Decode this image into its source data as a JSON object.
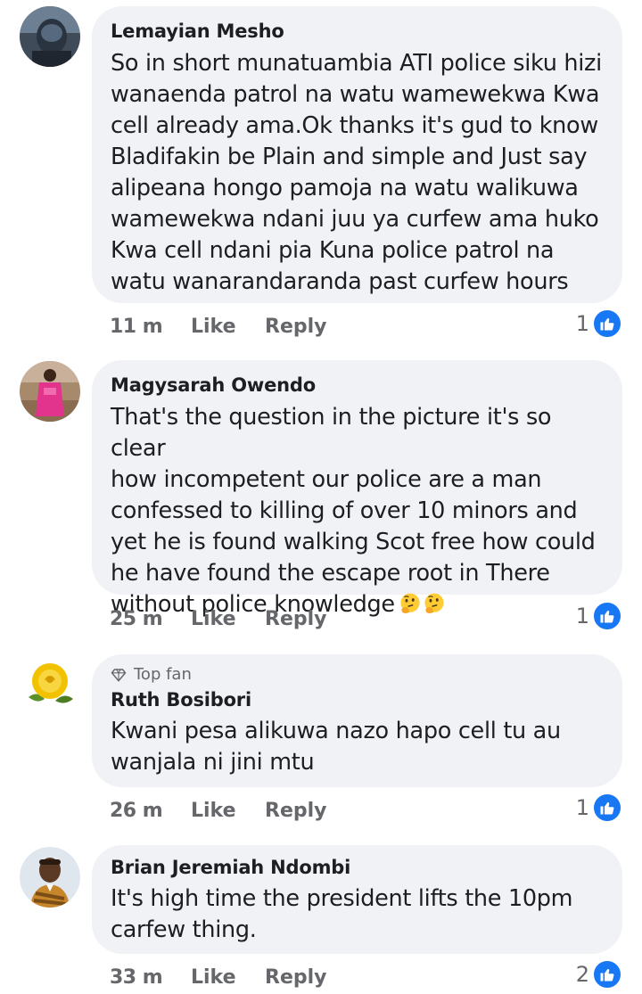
{
  "comments": [
    {
      "author": "Lemayian Mesho",
      "text": "So in short munatuambia ATI police siku hizi\nwanaenda patrol na watu wamewekwa Kwa\ncell already ama.Ok thanks it's gud to know\nBladifakin be Plain and simple and Just say\nalipeana hongo pamoja na watu walikuwa\nwamewekwa ndani juu ya curfew ama huko\nKwa cell ndani pia Kuna police patrol na\nwatu wanarandaranda past curfew hours",
      "time": "11 m",
      "like_label": "Like",
      "reply_label": "Reply",
      "reaction_count": "1",
      "avatar": "dark-portrait-avatar"
    },
    {
      "author": "Magysarah Owendo",
      "text": "That's the question in the picture  it's so clear\nhow incompetent our police are a man\nconfessed to killing of over 10 minors  and\nyet he is found walking Scot free how could\nhe have found the escape root in  There\nwithout police knowledge",
      "emojis": [
        "thinking-face-emoji",
        "thinking-face-emoji"
      ],
      "time": "25 m",
      "like_label": "Like",
      "reply_label": "Reply",
      "reaction_count": "1",
      "avatar": "pink-dress-avatar"
    },
    {
      "badge": "Top fan",
      "badge_icon": "diamond-icon",
      "author": "Ruth Bosibori",
      "text": "Kwani pesa alikuwa nazo hapo cell tu au\nwanjala ni jini mtu",
      "time": "26 m",
      "like_label": "Like",
      "reply_label": "Reply",
      "reaction_count": "1",
      "avatar": "yellow-rose-avatar"
    },
    {
      "author": "Brian Jeremiah Ndombi",
      "text": "It's high time the president lifts the 10pm\ncarfew thing.",
      "time": "33 m",
      "like_label": "Like",
      "reply_label": "Reply",
      "reaction_count": "2",
      "avatar": "man-portrait-avatar"
    }
  ],
  "colors": {
    "bubble": "#f0f2f5",
    "meta_text": "#65676b",
    "like_blue": "#1877f2",
    "text": "#1c1e21"
  }
}
